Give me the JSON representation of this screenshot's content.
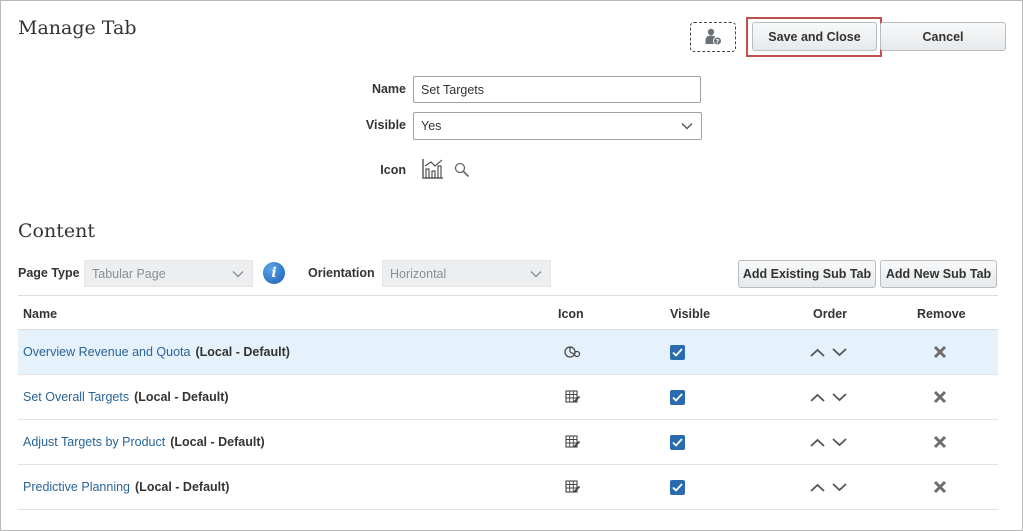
{
  "header": {
    "title": "Manage Tab",
    "save_label": "Save and Close",
    "cancel_label": "Cancel"
  },
  "form": {
    "name_label": "Name",
    "name_value": "Set Targets",
    "visible_label": "Visible",
    "visible_value": "Yes",
    "icon_label": "Icon"
  },
  "content": {
    "title": "Content",
    "page_type_label": "Page Type",
    "page_type_value": "Tabular Page",
    "orientation_label": "Orientation",
    "orientation_value": "Horizontal",
    "add_existing_label": "Add Existing Sub Tab",
    "add_new_label": "Add New Sub Tab"
  },
  "table": {
    "columns": [
      "Name",
      "Icon",
      "Visible",
      "Order",
      "Remove"
    ],
    "rows": [
      {
        "name": "Overview Revenue and Quota",
        "suffix": "(Local - Default)",
        "icon": "dashboard-icon",
        "visible": true
      },
      {
        "name": "Set Overall Targets",
        "suffix": "(Local - Default)",
        "icon": "grid-edit-icon",
        "visible": true
      },
      {
        "name": "Adjust Targets by Product",
        "suffix": "(Local - Default)",
        "icon": "grid-edit-icon",
        "visible": true
      },
      {
        "name": "Predictive Planning",
        "suffix": "(Local - Default)",
        "icon": "grid-edit-icon",
        "visible": true
      }
    ]
  },
  "colors": {
    "accent": "#2a6bb0",
    "link": "#2a6496",
    "highlight_border": "#c0504d",
    "selected_row": "#e5f1fb"
  }
}
